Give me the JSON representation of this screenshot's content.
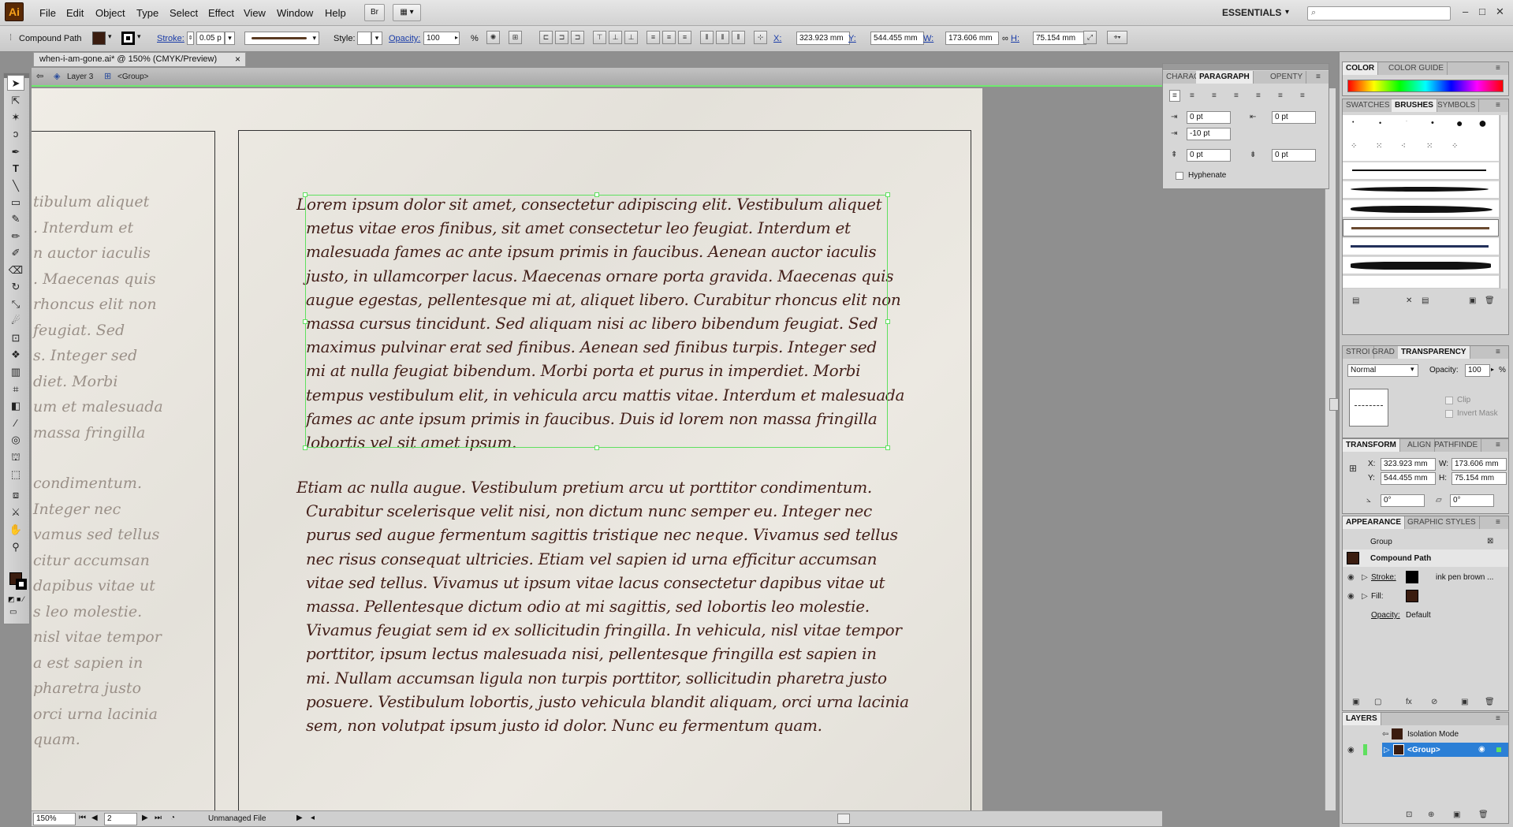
{
  "app": {
    "logo": "Ai"
  },
  "menu": [
    "File",
    "Edit",
    "Object",
    "Type",
    "Select",
    "Effect",
    "View",
    "Window",
    "Help"
  ],
  "toolbar_top": {
    "bridge": "Br",
    "workspace": "ESSENTIALS",
    "search_placeholder": "",
    "min": "–",
    "max": "□",
    "close": "✕"
  },
  "control": {
    "selection_type": "Compound Path",
    "stroke_label": "Stroke:",
    "stroke_value": "0.05 p",
    "style_label": "Style:",
    "opacity_label": "Opacity:",
    "opacity_value": "100",
    "opacity_unit": "%",
    "x_label": "X:",
    "x_value": "323.923 mm",
    "y_label": "Y:",
    "y_value": "544.455 mm",
    "w_label": "W:",
    "w_value": "173.606 mm",
    "h_label": "H:",
    "h_value": "75.154 mm"
  },
  "document": {
    "tab_title": "when-i-am-gone.ai* @ 150% (CMYK/Preview)",
    "tab_close": "×",
    "breadcrumb_layer": "Layer 3",
    "breadcrumb_group": "<Group>"
  },
  "page_text": {
    "p1": [
      "Lorem ipsum dolor sit amet, consectetur adipiscing elit. Vestibulum aliquet",
      "metus vitae eros finibus, sit amet consectetur leo feugiat. Interdum et",
      "malesuada fames ac ante ipsum primis in faucibus. Aenean auctor iaculis",
      "justo, in ullamcorper lacus. Maecenas ornare porta gravida. Maecenas quis",
      "augue egestas, pellentesque mi at, aliquet libero. Curabitur rhoncus elit non",
      "massa cursus tincidunt. Sed aliquam nisi ac libero bibendum feugiat. Sed",
      "maximus pulvinar erat sed finibus. Aenean sed finibus turpis. Integer sed",
      "mi at nulla feugiat bibendum. Morbi porta et purus in imperdiet. Morbi",
      "tempus vestibulum elit, in vehicula arcu mattis vitae. Interdum et malesuada",
      "fames ac ante ipsum primis in faucibus. Duis id lorem non massa fringilla",
      "lobortis vel sit amet ipsum."
    ],
    "p2": [
      "Etiam ac nulla augue. Vestibulum pretium arcu ut porttitor condimentum.",
      "Curabitur scelerisque velit nisi, non dictum nunc semper eu. Integer nec",
      "purus sed augue fermentum sagittis tristique nec neque. Vivamus sed tellus",
      "nec risus consequat ultricies. Etiam vel sapien id urna efficitur accumsan",
      "vitae sed tellus. Vivamus ut ipsum vitae lacus consectetur dapibus vitae ut",
      "massa. Pellentesque dictum odio at mi sagittis, sed lobortis leo molestie.",
      "Vivamus feugiat sem id ex sollicitudin fringilla. In vehicula, nisl vitae tempor",
      "porttitor, ipsum lectus malesuada nisi, pellentesque fringilla est sapien in",
      "mi. Nullam accumsan ligula non turpis porttitor, sollicitudin pharetra justo",
      "posuere. Vestibulum lobortis, justo vehicula blandit aliquam, orci urna lacinia",
      "sem, non volutpat ipsum justo id dolor. Nunc eu fermentum quam."
    ],
    "ghost": [
      "tibulum aliquet",
      ". Interdum et",
      "n auctor iaculis",
      ". Maecenas quis",
      "rhoncus elit non",
      "feugiat. Sed",
      "s. Integer sed",
      "diet. Morbi",
      "um et malesuada",
      "massa fringilla",
      "",
      "condimentum.",
      "Integer nec",
      "vamus sed tellus",
      "citur accumsan",
      "dapibus vitae ut",
      "s leo molestie.",
      "nisl vitae tempor",
      "a est sapien in",
      "pharetra justo",
      "orci urna lacinia",
      "quam."
    ]
  },
  "status": {
    "zoom": "150%",
    "artboard": "2",
    "file_status": "Unmanaged File"
  },
  "paragraph_panel": {
    "tabs": [
      "CHARAC",
      "PARAGRAPH",
      "OPENTY"
    ],
    "left_indent": "0 pt",
    "right_indent": "0 pt",
    "first_line": "-10 pt",
    "space_before": "0 pt",
    "space_after": "0 pt",
    "hyphenate": "Hyphenate"
  },
  "color_panel": {
    "tabs": [
      "COLOR",
      "COLOR GUIDE"
    ]
  },
  "brushes_panel": {
    "tabs": [
      "SWATCHES",
      "BRUSHES",
      "SYMBOLS"
    ]
  },
  "transparency_panel": {
    "tabs": [
      "STROI",
      "GRAD",
      "TRANSPARENCY"
    ],
    "mode": "Normal",
    "opacity_label": "Opacity:",
    "opacity": "100",
    "unit": "%",
    "clip": "Clip",
    "invert": "Invert Mask"
  },
  "transform_panel": {
    "tabs": [
      "TRANSFORM",
      "ALIGN",
      "PATHFINDE"
    ],
    "x": "323.923 mm",
    "y": "544.455 mm",
    "w": "173.606 mm",
    "h": "75.154 mm",
    "x_label": "X:",
    "y_label": "Y:",
    "w_label": "W:",
    "h_label": "H:",
    "rotate": "0°",
    "shear": "0°"
  },
  "appearance_panel": {
    "tabs": [
      "APPEARANCE",
      "GRAPHIC STYLES"
    ],
    "group": "Group",
    "object": "Compound Path",
    "stroke_label": "Stroke:",
    "stroke_value": "ink pen brown ...",
    "fill_label": "Fill:",
    "opacity_label": "Opacity:",
    "opacity_value": "Default"
  },
  "layers_panel": {
    "tab": "LAYERS",
    "isolation": "Isolation Mode",
    "group": "<Group>"
  },
  "colors": {
    "ink": "#43201a",
    "highlight": "#7cf06a",
    "selection": "#5fe05f",
    "layer_select": "#2b7fd6"
  }
}
